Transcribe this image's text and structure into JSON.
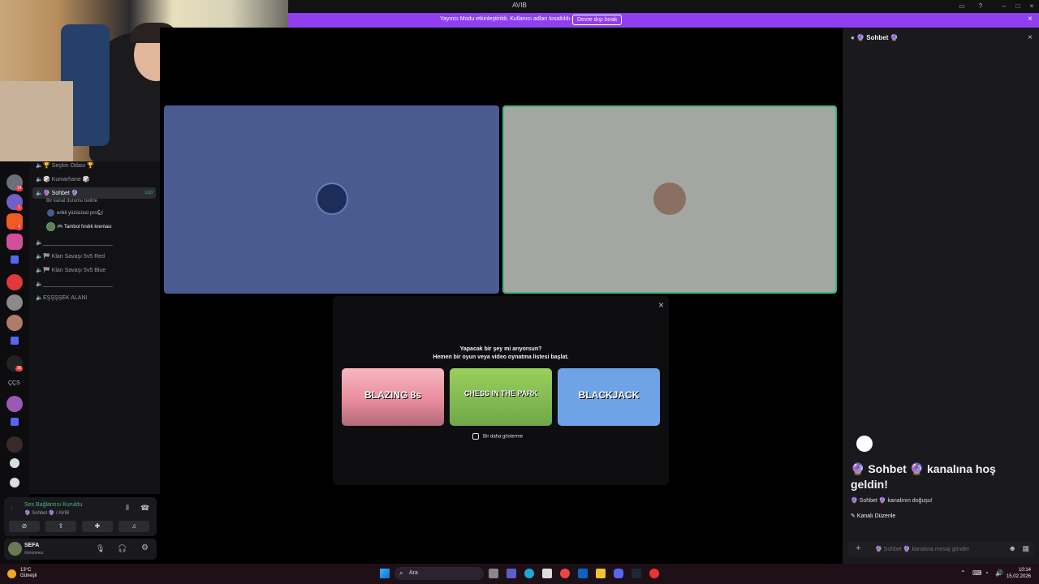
{
  "window": {
    "title": "AVIB"
  },
  "banner": {
    "message": "Yayıncı Modu etkinleştirildi. Kullanıcı adları kısaltıldı.",
    "button": "Devre dışı bırak"
  },
  "channels": [
    {
      "label": "🏆 Seçkin Odası 🏆"
    },
    {
      "label": "🎲 Kumarhane 🎲"
    },
    {
      "label": "🔮 Sohbet 🔮",
      "count": "1/10",
      "status": "Bir kanal durumu belirle"
    },
    {
      "label": "______________________"
    },
    {
      "label": "🏁 Klan Savaşı 5v5 Red"
    },
    {
      "label": "🏁 Klan Savaşı 5v5 Blue"
    },
    {
      "label": "______________________"
    },
    {
      "label": "EŞŞŞŞEK ALANI"
    }
  ],
  "members": [
    {
      "name": "erikli yüzücüsü pro🐿"
    },
    {
      "name": "🎮 Tambol fındık kreması"
    }
  ],
  "rail": {
    "label": "ÇÇS"
  },
  "voice": {
    "status": "Ses Bağlantısı Kuruldu",
    "location": "🔮 Sohbet 🔮 / AVIB"
  },
  "user": {
    "name": "SEFA",
    "status": "Görünmez"
  },
  "activity": {
    "line1": "Yapacak bir şey mi arıyorsun?",
    "line2": "Hemen bir oyun veya video oynatma listesi başlat.",
    "games": [
      "BLAZING 8s",
      "CHESS IN THE PARK",
      "BLACKJACK"
    ],
    "dont_show": "Bir daha gösterme"
  },
  "chat": {
    "header": "🔮 Sohbet 🔮",
    "welcome": "🔮 Sohbet 🔮 kanalına hoş geldin!",
    "origin": "🔮 Sohbet 🔮 kanalının doğuşu!",
    "edit": "✎ Kanalı Düzenle",
    "placeholder": "🔮 Sohbet 🔮 kanalına mesaj gönder"
  },
  "taskbar": {
    "temp": "13°C",
    "weather": "Güneşli",
    "search": "Ara",
    "time": "10:14",
    "date": "15.02.2026"
  },
  "colors": {
    "banner": "#8f3ff0",
    "tile_blue": "#4a5b92",
    "tile_gray": "#a4a6a1",
    "speaking": "#43b581"
  }
}
